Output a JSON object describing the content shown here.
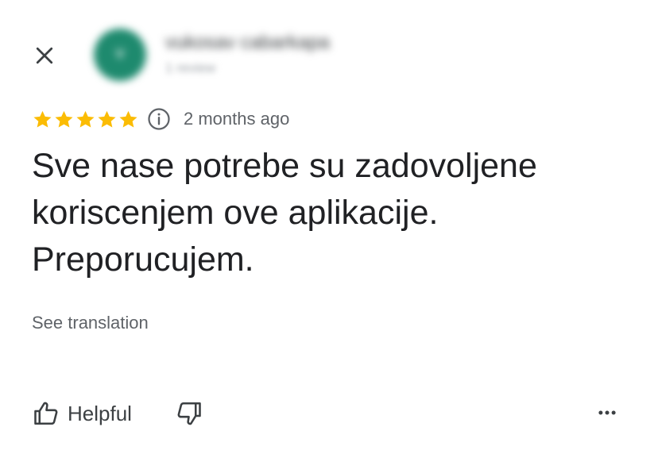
{
  "author": {
    "name": "vukosav cabarkapa",
    "meta": "1 review",
    "avatar_initial": "V",
    "avatar_color": "#1e8a6e"
  },
  "review": {
    "rating": 5,
    "rating_max": 5,
    "star_color": "#fbbc04",
    "date": "2 months ago",
    "text": "Sve nase potrebe su zadovoljene koriscenjem ove aplikacije. Preporucujem.",
    "see_translation_label": "See translation"
  },
  "actions": {
    "helpful_label": "Helpful"
  },
  "icons": {
    "close": "close-icon",
    "info": "info-icon",
    "thumbs_up": "thumbs-up-icon",
    "thumbs_down": "thumbs-down-icon",
    "more": "more-horizontal-icon"
  }
}
